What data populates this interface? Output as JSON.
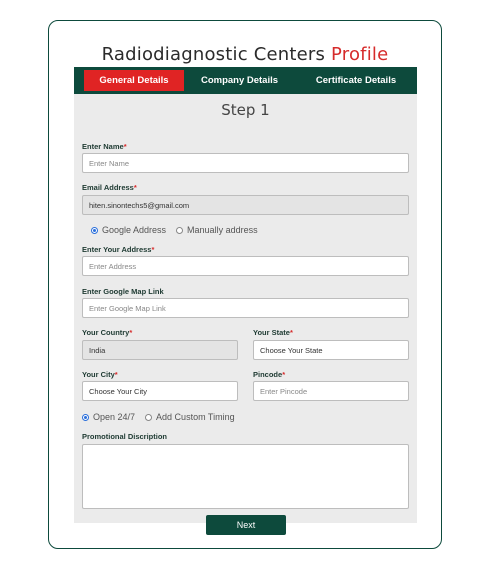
{
  "page": {
    "title_main": "Radiodiagnostic Centers",
    "title_accent": "Profile"
  },
  "tabs": [
    {
      "label": "General Details",
      "active": true
    },
    {
      "label": "Company Details",
      "active": false
    },
    {
      "label": "Certificate Details",
      "active": false
    }
  ],
  "form": {
    "step": "Step 1",
    "name": {
      "label": "Enter Name",
      "placeholder": "Enter  Name",
      "value": ""
    },
    "email": {
      "label": "Email Address",
      "value": "hiten.sinontechs5@gmail.com"
    },
    "address_mode": {
      "options": [
        "Google Address",
        "Manually address"
      ],
      "selected": "Google Address"
    },
    "address": {
      "label": "Enter Your Address",
      "placeholder": "Enter Address"
    },
    "map_link": {
      "label": "Enter Google Map Link",
      "placeholder": "Enter Google Map Link"
    },
    "country": {
      "label": "Your Country",
      "value": "India"
    },
    "state": {
      "label": "Your State",
      "value": "Choose Your State"
    },
    "city": {
      "label": "Your City",
      "value": "Choose Your City"
    },
    "pincode": {
      "label": "Pincode",
      "placeholder": "Enter Pincode"
    },
    "timing": {
      "options": [
        "Open 24/7",
        "Add Custom Timing"
      ],
      "selected": "Open 24/7"
    },
    "promo": {
      "label": "Promotional Discription",
      "value": ""
    },
    "next_label": "Next"
  },
  "colors": {
    "brand": "#0d4a3c",
    "accent": "#e02424",
    "radio": "#2a6fdb"
  }
}
